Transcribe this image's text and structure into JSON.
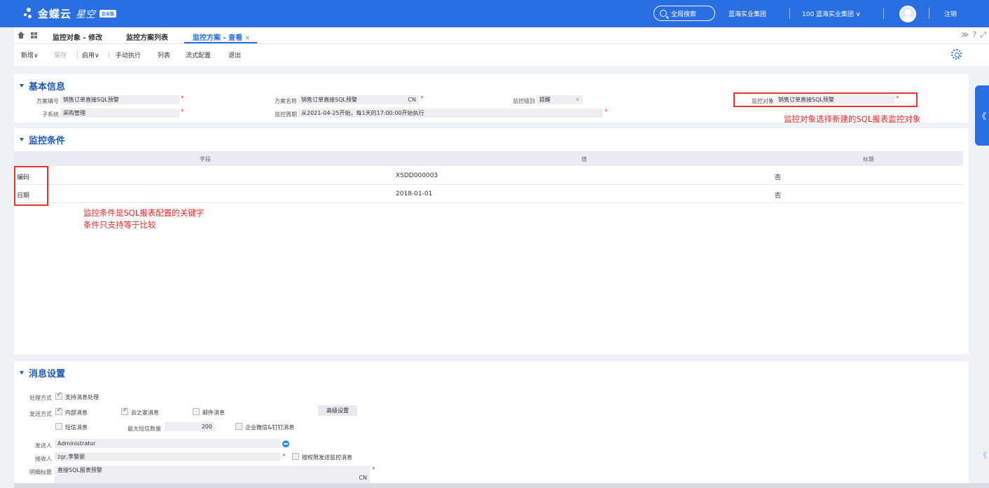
{
  "app": {
    "brand": "金蝶云",
    "brand_sub": "星空",
    "brand_badge": "企业版",
    "search_label": "全局搜索",
    "org_group": "蓝海实业集团",
    "org_current": "100 蓝海实业集团",
    "logout": "注销"
  },
  "tabs": [
    {
      "label": "监控对象 - 修改"
    },
    {
      "label": "监控方案列表"
    },
    {
      "label": "监控方案 - 查看"
    }
  ],
  "tab_close": "×",
  "tab_tools": {
    "collapse": "≫",
    "help": "?",
    "fullscreen": "⤢"
  },
  "toolbar": {
    "new": "新增",
    "save": "保存",
    "enable": "启用",
    "manual_run": "手动执行",
    "list": "列表",
    "flow_config": "流式配置",
    "exit": "退出",
    "caret": "∨"
  },
  "basic": {
    "title": "基本信息",
    "scheme_code_label": "方案编号",
    "scheme_code": "销售订单直接SQL预警",
    "scheme_name_label": "方案名称",
    "scheme_name": "销售订单直接SQL预警",
    "scheme_name_lang": "CN",
    "level_label": "监控级别",
    "level": "提醒",
    "object_label": "监控对象",
    "object": "销售订单直接SQL预警",
    "subsystem_label": "子系统",
    "subsystem": "采购管理",
    "period_label": "监控周期",
    "period": "从2021-04-25开始，每1天的17:00:00开始执行",
    "required": "*"
  },
  "annotations": {
    "object_note": "监控对象选择新建的SQL报表监控对象",
    "condition_note_1": "监控条件是SQL报表配置的关键字",
    "condition_note_2": "条件只支持等于比较"
  },
  "conditions": {
    "title": "监控条件",
    "columns": [
      "字段",
      "值",
      "标题"
    ],
    "rows": [
      {
        "field": "编码",
        "value": "XSDD000003",
        "title": "否"
      },
      {
        "field": "日期",
        "value": "2018-01-01",
        "title": "否"
      }
    ]
  },
  "message": {
    "title": "消息设置",
    "handle_label": "处理方式",
    "support_handle": "支持消息处理",
    "send_label": "发送方式",
    "internal_msg": "内部消息",
    "yzj_msg": "云之家消息",
    "mail_msg": "邮件消息",
    "advanced": "高级设置",
    "sms_msg": "短信消息",
    "max_sms_label": "最大短信数量",
    "max_sms": "200",
    "wechat_msg": "企业微信&钉钉消息",
    "sender_label": "发送人",
    "sender": "Administrator",
    "receiver_label": "接收人",
    "receiver": "zgr,李警丽",
    "perm_send": "按权限发送监控消息",
    "detail_title_label": "明细标题",
    "detail_title": "直接SQL报表预警",
    "detail_lang": "CN"
  },
  "side": {
    "expand": "《",
    "collapse": "《"
  }
}
